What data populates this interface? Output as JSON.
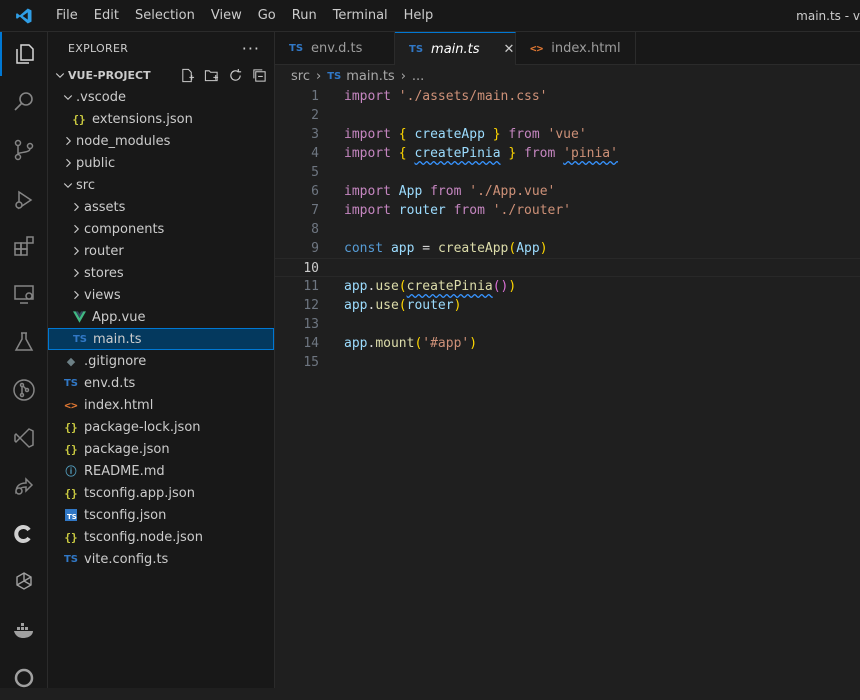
{
  "menu": [
    "File",
    "Edit",
    "Selection",
    "View",
    "Go",
    "Run",
    "Terminal",
    "Help"
  ],
  "window_title": "main.ts - v",
  "activity_icons": [
    "explorer-icon",
    "search-icon",
    "source-control-icon",
    "run-debug-icon",
    "extensions-icon",
    "remote-explorer-icon",
    "testing-icon",
    "git-graph-icon",
    "visual-studio-icon",
    "live-share-icon",
    "codeium-icon",
    "openai-icon",
    "docker-icon",
    "circle-icon"
  ],
  "sidebar": {
    "title": "EXPLORER",
    "more": "···",
    "project": "VUE-PROJECT",
    "tree": [
      {
        "label": ".vscode",
        "type": "folder",
        "open": true,
        "depth": 1
      },
      {
        "label": "extensions.json",
        "type": "json",
        "depth": 2
      },
      {
        "label": "node_modules",
        "type": "folder",
        "open": false,
        "depth": 1
      },
      {
        "label": "public",
        "type": "folder",
        "open": false,
        "depth": 1
      },
      {
        "label": "src",
        "type": "folder",
        "open": true,
        "depth": 1
      },
      {
        "label": "assets",
        "type": "folder",
        "open": false,
        "depth": 2
      },
      {
        "label": "components",
        "type": "folder",
        "open": false,
        "depth": 2
      },
      {
        "label": "router",
        "type": "folder",
        "open": false,
        "depth": 2
      },
      {
        "label": "stores",
        "type": "folder",
        "open": false,
        "depth": 2
      },
      {
        "label": "views",
        "type": "folder",
        "open": false,
        "depth": 2
      },
      {
        "label": "App.vue",
        "type": "vue",
        "depth": 2
      },
      {
        "label": "main.ts",
        "type": "ts",
        "depth": 2,
        "selected": true
      },
      {
        "label": ".gitignore",
        "type": "git",
        "depth": 1
      },
      {
        "label": "env.d.ts",
        "type": "ts",
        "depth": 1
      },
      {
        "label": "index.html",
        "type": "html",
        "depth": 1
      },
      {
        "label": "package-lock.json",
        "type": "json",
        "depth": 1
      },
      {
        "label": "package.json",
        "type": "json",
        "depth": 1
      },
      {
        "label": "README.md",
        "type": "info",
        "depth": 1
      },
      {
        "label": "tsconfig.app.json",
        "type": "json",
        "depth": 1
      },
      {
        "label": "tsconfig.json",
        "type": "tsconfig",
        "depth": 1
      },
      {
        "label": "tsconfig.node.json",
        "type": "json",
        "depth": 1
      },
      {
        "label": "vite.config.ts",
        "type": "ts",
        "depth": 1
      }
    ]
  },
  "tabs": [
    {
      "label": "env.d.ts",
      "icon": "TS",
      "active": false
    },
    {
      "label": "main.ts",
      "icon": "TS",
      "active": true,
      "close": "✕"
    },
    {
      "label": "index.html",
      "icon": "<>",
      "active": false
    }
  ],
  "breadcrumb": {
    "folder": "src",
    "file": "main.ts",
    "sep": "›",
    "more": "..."
  },
  "editor": {
    "current_line": 10,
    "lines": [
      [
        [
          "kw",
          "import"
        ],
        [
          "plain",
          " "
        ],
        [
          "str",
          "'./assets/main.css'"
        ]
      ],
      [],
      [
        [
          "kw",
          "import"
        ],
        [
          "plain",
          " "
        ],
        [
          "br1",
          "{"
        ],
        [
          "plain",
          " "
        ],
        [
          "var",
          "createApp"
        ],
        [
          "plain",
          " "
        ],
        [
          "br1",
          "}"
        ],
        [
          "plain",
          " "
        ],
        [
          "kw",
          "from"
        ],
        [
          "plain",
          " "
        ],
        [
          "str",
          "'vue'"
        ]
      ],
      [
        [
          "kw",
          "import"
        ],
        [
          "plain",
          " "
        ],
        [
          "br1",
          "{"
        ],
        [
          "plain",
          " "
        ],
        [
          "var squig",
          "createPinia"
        ],
        [
          "plain",
          " "
        ],
        [
          "br1",
          "}"
        ],
        [
          "plain",
          " "
        ],
        [
          "kw",
          "from"
        ],
        [
          "plain",
          " "
        ],
        [
          "str squig",
          "'pinia'"
        ]
      ],
      [],
      [
        [
          "kw",
          "import"
        ],
        [
          "plain",
          " "
        ],
        [
          "var",
          "App"
        ],
        [
          "plain",
          " "
        ],
        [
          "kw",
          "from"
        ],
        [
          "plain",
          " "
        ],
        [
          "str",
          "'./App.vue'"
        ]
      ],
      [
        [
          "kw",
          "import"
        ],
        [
          "plain",
          " "
        ],
        [
          "var",
          "router"
        ],
        [
          "plain",
          " "
        ],
        [
          "kw",
          "from"
        ],
        [
          "plain",
          " "
        ],
        [
          "str",
          "'./router'"
        ]
      ],
      [],
      [
        [
          "kwb",
          "const"
        ],
        [
          "plain",
          " "
        ],
        [
          "var",
          "app"
        ],
        [
          "plain",
          " = "
        ],
        [
          "fn",
          "createApp"
        ],
        [
          "br1",
          "("
        ],
        [
          "var",
          "App"
        ],
        [
          "br1",
          ")"
        ]
      ],
      [],
      [
        [
          "var",
          "app"
        ],
        [
          "plain",
          "."
        ],
        [
          "fn",
          "use"
        ],
        [
          "br1",
          "("
        ],
        [
          "fn squig",
          "createPinia"
        ],
        [
          "br2",
          "()"
        ],
        [
          "br1",
          ")"
        ]
      ],
      [
        [
          "var",
          "app"
        ],
        [
          "plain",
          "."
        ],
        [
          "fn",
          "use"
        ],
        [
          "br1",
          "("
        ],
        [
          "var",
          "router"
        ],
        [
          "br1",
          ")"
        ]
      ],
      [],
      [
        [
          "var",
          "app"
        ],
        [
          "plain",
          "."
        ],
        [
          "fn",
          "mount"
        ],
        [
          "br1",
          "("
        ],
        [
          "str",
          "'#app'"
        ],
        [
          "br1",
          ")"
        ]
      ],
      []
    ]
  }
}
